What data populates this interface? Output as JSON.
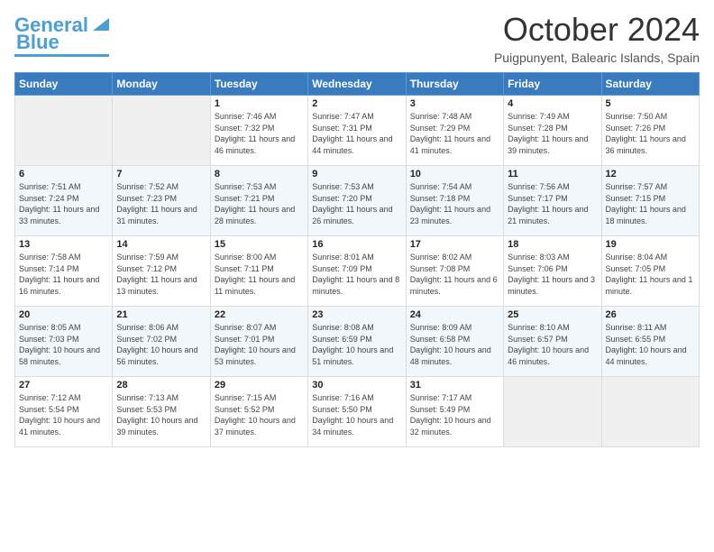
{
  "header": {
    "logo_line1": "General",
    "logo_line2": "Blue",
    "month": "October 2024",
    "location": "Puigpunyent, Balearic Islands, Spain"
  },
  "days_of_week": [
    "Sunday",
    "Monday",
    "Tuesday",
    "Wednesday",
    "Thursday",
    "Friday",
    "Saturday"
  ],
  "weeks": [
    [
      {
        "num": "",
        "info": ""
      },
      {
        "num": "",
        "info": ""
      },
      {
        "num": "1",
        "info": "Sunrise: 7:46 AM\nSunset: 7:32 PM\nDaylight: 11 hours\nand 46 minutes."
      },
      {
        "num": "2",
        "info": "Sunrise: 7:47 AM\nSunset: 7:31 PM\nDaylight: 11 hours\nand 44 minutes."
      },
      {
        "num": "3",
        "info": "Sunrise: 7:48 AM\nSunset: 7:29 PM\nDaylight: 11 hours\nand 41 minutes."
      },
      {
        "num": "4",
        "info": "Sunrise: 7:49 AM\nSunset: 7:28 PM\nDaylight: 11 hours\nand 39 minutes."
      },
      {
        "num": "5",
        "info": "Sunrise: 7:50 AM\nSunset: 7:26 PM\nDaylight: 11 hours\nand 36 minutes."
      }
    ],
    [
      {
        "num": "6",
        "info": "Sunrise: 7:51 AM\nSunset: 7:24 PM\nDaylight: 11 hours\nand 33 minutes."
      },
      {
        "num": "7",
        "info": "Sunrise: 7:52 AM\nSunset: 7:23 PM\nDaylight: 11 hours\nand 31 minutes."
      },
      {
        "num": "8",
        "info": "Sunrise: 7:53 AM\nSunset: 7:21 PM\nDaylight: 11 hours\nand 28 minutes."
      },
      {
        "num": "9",
        "info": "Sunrise: 7:53 AM\nSunset: 7:20 PM\nDaylight: 11 hours\nand 26 minutes."
      },
      {
        "num": "10",
        "info": "Sunrise: 7:54 AM\nSunset: 7:18 PM\nDaylight: 11 hours\nand 23 minutes."
      },
      {
        "num": "11",
        "info": "Sunrise: 7:56 AM\nSunset: 7:17 PM\nDaylight: 11 hours\nand 21 minutes."
      },
      {
        "num": "12",
        "info": "Sunrise: 7:57 AM\nSunset: 7:15 PM\nDaylight: 11 hours\nand 18 minutes."
      }
    ],
    [
      {
        "num": "13",
        "info": "Sunrise: 7:58 AM\nSunset: 7:14 PM\nDaylight: 11 hours\nand 16 minutes."
      },
      {
        "num": "14",
        "info": "Sunrise: 7:59 AM\nSunset: 7:12 PM\nDaylight: 11 hours\nand 13 minutes."
      },
      {
        "num": "15",
        "info": "Sunrise: 8:00 AM\nSunset: 7:11 PM\nDaylight: 11 hours\nand 11 minutes."
      },
      {
        "num": "16",
        "info": "Sunrise: 8:01 AM\nSunset: 7:09 PM\nDaylight: 11 hours\nand 8 minutes."
      },
      {
        "num": "17",
        "info": "Sunrise: 8:02 AM\nSunset: 7:08 PM\nDaylight: 11 hours\nand 6 minutes."
      },
      {
        "num": "18",
        "info": "Sunrise: 8:03 AM\nSunset: 7:06 PM\nDaylight: 11 hours\nand 3 minutes."
      },
      {
        "num": "19",
        "info": "Sunrise: 8:04 AM\nSunset: 7:05 PM\nDaylight: 11 hours\nand 1 minute."
      }
    ],
    [
      {
        "num": "20",
        "info": "Sunrise: 8:05 AM\nSunset: 7:03 PM\nDaylight: 10 hours\nand 58 minutes."
      },
      {
        "num": "21",
        "info": "Sunrise: 8:06 AM\nSunset: 7:02 PM\nDaylight: 10 hours\nand 56 minutes."
      },
      {
        "num": "22",
        "info": "Sunrise: 8:07 AM\nSunset: 7:01 PM\nDaylight: 10 hours\nand 53 minutes."
      },
      {
        "num": "23",
        "info": "Sunrise: 8:08 AM\nSunset: 6:59 PM\nDaylight: 10 hours\nand 51 minutes."
      },
      {
        "num": "24",
        "info": "Sunrise: 8:09 AM\nSunset: 6:58 PM\nDaylight: 10 hours\nand 48 minutes."
      },
      {
        "num": "25",
        "info": "Sunrise: 8:10 AM\nSunset: 6:57 PM\nDaylight: 10 hours\nand 46 minutes."
      },
      {
        "num": "26",
        "info": "Sunrise: 8:11 AM\nSunset: 6:55 PM\nDaylight: 10 hours\nand 44 minutes."
      }
    ],
    [
      {
        "num": "27",
        "info": "Sunrise: 7:12 AM\nSunset: 5:54 PM\nDaylight: 10 hours\nand 41 minutes."
      },
      {
        "num": "28",
        "info": "Sunrise: 7:13 AM\nSunset: 5:53 PM\nDaylight: 10 hours\nand 39 minutes."
      },
      {
        "num": "29",
        "info": "Sunrise: 7:15 AM\nSunset: 5:52 PM\nDaylight: 10 hours\nand 37 minutes."
      },
      {
        "num": "30",
        "info": "Sunrise: 7:16 AM\nSunset: 5:50 PM\nDaylight: 10 hours\nand 34 minutes."
      },
      {
        "num": "31",
        "info": "Sunrise: 7:17 AM\nSunset: 5:49 PM\nDaylight: 10 hours\nand 32 minutes."
      },
      {
        "num": "",
        "info": ""
      },
      {
        "num": "",
        "info": ""
      }
    ]
  ]
}
